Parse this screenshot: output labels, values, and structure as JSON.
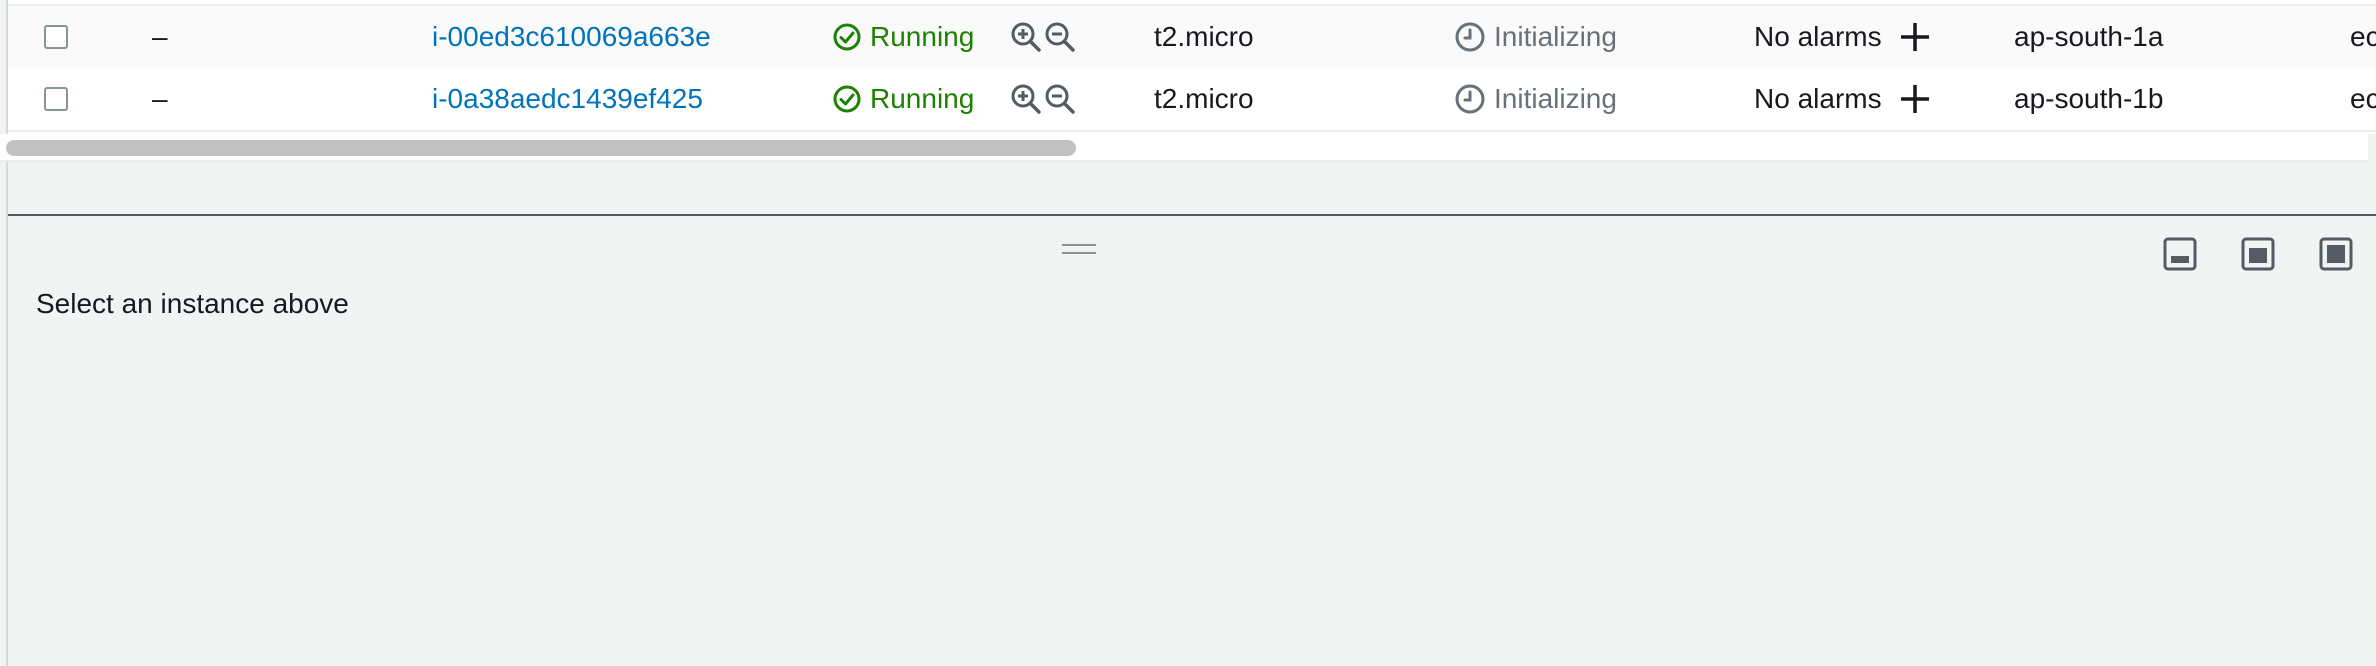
{
  "instances": [
    {
      "name": "–",
      "instance_id": "i-00ed3c610069a663e",
      "state": "Running",
      "type": "t2.micro",
      "status_check": "Initializing",
      "alarm_status": "No alarms",
      "availability_zone": "ap-south-1a",
      "public_dns": "ec"
    },
    {
      "name": "–",
      "instance_id": "i-0a38aedc1439ef425",
      "state": "Running",
      "type": "t2.micro",
      "status_check": "Initializing",
      "alarm_status": "No alarms",
      "availability_zone": "ap-south-1b",
      "public_dns": "ec"
    }
  ],
  "detail_panel": {
    "empty_message": "Select an instance above"
  },
  "icons": {
    "state": "check-circle-icon",
    "zoom_in": "zoom-in-icon",
    "zoom_out": "zoom-out-icon",
    "status": "clock-icon",
    "add_alarm": "plus-icon",
    "panel_bottom": "panel-bottom-icon",
    "panel_side": "panel-side-icon",
    "panel_full": "panel-full-icon"
  },
  "colors": {
    "link": "#0073bb",
    "running": "#1d8102",
    "muted": "#687078"
  }
}
